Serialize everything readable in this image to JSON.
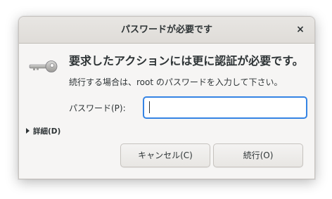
{
  "window": {
    "title": "パスワードが必要です",
    "close_label": "×"
  },
  "dialog": {
    "icon": "key-icon",
    "heading": "要求したアクションには更に認証が必要です。",
    "message": "続行する場合は、root のパスワードを入力して下さい。",
    "password_label": "パスワード(P):",
    "password_value": "",
    "details_label": "詳細(D)"
  },
  "buttons": {
    "cancel_label": "キャンセル(C)",
    "ok_label": "続行(O)"
  },
  "colors": {
    "accent": "#3584e4",
    "background": "#f6f5f4",
    "text": "#2e3436"
  }
}
